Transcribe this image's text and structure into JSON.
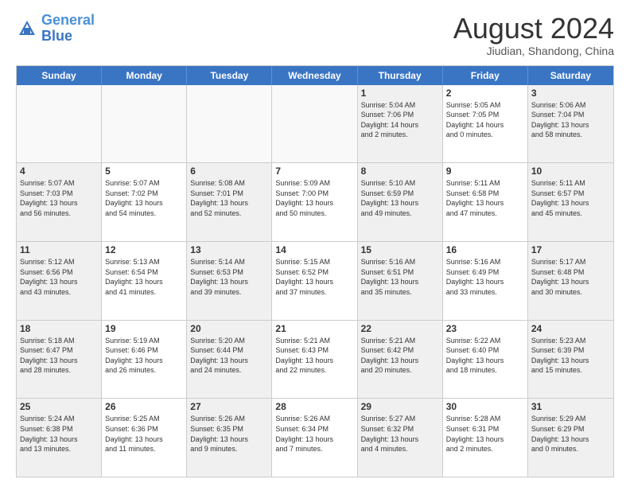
{
  "logo": {
    "line1": "General",
    "line2": "Blue"
  },
  "title": "August 2024",
  "subtitle": "Jiudian, Shandong, China",
  "headers": [
    "Sunday",
    "Monday",
    "Tuesday",
    "Wednesday",
    "Thursday",
    "Friday",
    "Saturday"
  ],
  "rows": [
    [
      {
        "day": "",
        "info": "",
        "empty": true
      },
      {
        "day": "",
        "info": "",
        "empty": true
      },
      {
        "day": "",
        "info": "",
        "empty": true
      },
      {
        "day": "",
        "info": "",
        "empty": true
      },
      {
        "day": "1",
        "info": "Sunrise: 5:04 AM\nSunset: 7:06 PM\nDaylight: 14 hours\nand 2 minutes."
      },
      {
        "day": "2",
        "info": "Sunrise: 5:05 AM\nSunset: 7:05 PM\nDaylight: 14 hours\nand 0 minutes."
      },
      {
        "day": "3",
        "info": "Sunrise: 5:06 AM\nSunset: 7:04 PM\nDaylight: 13 hours\nand 58 minutes."
      }
    ],
    [
      {
        "day": "4",
        "info": "Sunrise: 5:07 AM\nSunset: 7:03 PM\nDaylight: 13 hours\nand 56 minutes."
      },
      {
        "day": "5",
        "info": "Sunrise: 5:07 AM\nSunset: 7:02 PM\nDaylight: 13 hours\nand 54 minutes."
      },
      {
        "day": "6",
        "info": "Sunrise: 5:08 AM\nSunset: 7:01 PM\nDaylight: 13 hours\nand 52 minutes."
      },
      {
        "day": "7",
        "info": "Sunrise: 5:09 AM\nSunset: 7:00 PM\nDaylight: 13 hours\nand 50 minutes."
      },
      {
        "day": "8",
        "info": "Sunrise: 5:10 AM\nSunset: 6:59 PM\nDaylight: 13 hours\nand 49 minutes."
      },
      {
        "day": "9",
        "info": "Sunrise: 5:11 AM\nSunset: 6:58 PM\nDaylight: 13 hours\nand 47 minutes."
      },
      {
        "day": "10",
        "info": "Sunrise: 5:11 AM\nSunset: 6:57 PM\nDaylight: 13 hours\nand 45 minutes."
      }
    ],
    [
      {
        "day": "11",
        "info": "Sunrise: 5:12 AM\nSunset: 6:56 PM\nDaylight: 13 hours\nand 43 minutes."
      },
      {
        "day": "12",
        "info": "Sunrise: 5:13 AM\nSunset: 6:54 PM\nDaylight: 13 hours\nand 41 minutes."
      },
      {
        "day": "13",
        "info": "Sunrise: 5:14 AM\nSunset: 6:53 PM\nDaylight: 13 hours\nand 39 minutes."
      },
      {
        "day": "14",
        "info": "Sunrise: 5:15 AM\nSunset: 6:52 PM\nDaylight: 13 hours\nand 37 minutes."
      },
      {
        "day": "15",
        "info": "Sunrise: 5:16 AM\nSunset: 6:51 PM\nDaylight: 13 hours\nand 35 minutes."
      },
      {
        "day": "16",
        "info": "Sunrise: 5:16 AM\nSunset: 6:49 PM\nDaylight: 13 hours\nand 33 minutes."
      },
      {
        "day": "17",
        "info": "Sunrise: 5:17 AM\nSunset: 6:48 PM\nDaylight: 13 hours\nand 30 minutes."
      }
    ],
    [
      {
        "day": "18",
        "info": "Sunrise: 5:18 AM\nSunset: 6:47 PM\nDaylight: 13 hours\nand 28 minutes."
      },
      {
        "day": "19",
        "info": "Sunrise: 5:19 AM\nSunset: 6:46 PM\nDaylight: 13 hours\nand 26 minutes."
      },
      {
        "day": "20",
        "info": "Sunrise: 5:20 AM\nSunset: 6:44 PM\nDaylight: 13 hours\nand 24 minutes."
      },
      {
        "day": "21",
        "info": "Sunrise: 5:21 AM\nSunset: 6:43 PM\nDaylight: 13 hours\nand 22 minutes."
      },
      {
        "day": "22",
        "info": "Sunrise: 5:21 AM\nSunset: 6:42 PM\nDaylight: 13 hours\nand 20 minutes."
      },
      {
        "day": "23",
        "info": "Sunrise: 5:22 AM\nSunset: 6:40 PM\nDaylight: 13 hours\nand 18 minutes."
      },
      {
        "day": "24",
        "info": "Sunrise: 5:23 AM\nSunset: 6:39 PM\nDaylight: 13 hours\nand 15 minutes."
      }
    ],
    [
      {
        "day": "25",
        "info": "Sunrise: 5:24 AM\nSunset: 6:38 PM\nDaylight: 13 hours\nand 13 minutes."
      },
      {
        "day": "26",
        "info": "Sunrise: 5:25 AM\nSunset: 6:36 PM\nDaylight: 13 hours\nand 11 minutes."
      },
      {
        "day": "27",
        "info": "Sunrise: 5:26 AM\nSunset: 6:35 PM\nDaylight: 13 hours\nand 9 minutes."
      },
      {
        "day": "28",
        "info": "Sunrise: 5:26 AM\nSunset: 6:34 PM\nDaylight: 13 hours\nand 7 minutes."
      },
      {
        "day": "29",
        "info": "Sunrise: 5:27 AM\nSunset: 6:32 PM\nDaylight: 13 hours\nand 4 minutes."
      },
      {
        "day": "30",
        "info": "Sunrise: 5:28 AM\nSunset: 6:31 PM\nDaylight: 13 hours\nand 2 minutes."
      },
      {
        "day": "31",
        "info": "Sunrise: 5:29 AM\nSunset: 6:29 PM\nDaylight: 13 hours\nand 0 minutes."
      }
    ]
  ]
}
